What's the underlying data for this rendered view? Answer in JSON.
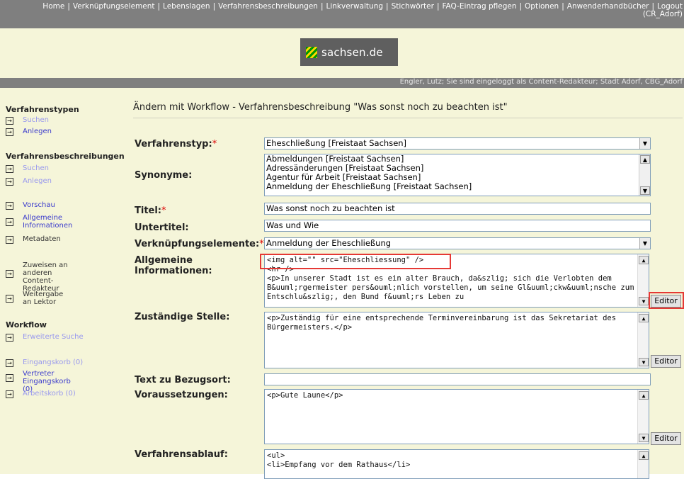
{
  "topnav": {
    "links": [
      "Home",
      "Verknüpfungselement",
      "Lebenslagen",
      "Verfahrensbeschreibungen",
      "Linkverwaltung",
      "Stichwörter",
      "FAQ-Eintrag pflegen",
      "Optionen",
      "Anwenderhandbücher",
      "Logout"
    ],
    "user_code": "(CR_Adorf)"
  },
  "logo": {
    "text": "sachsen.de"
  },
  "userbar": {
    "text": "Engler, Lutz; Sie sind eingeloggt als Content-Redakteur; Stadt Adorf, CBG_Adorf"
  },
  "sidebar": {
    "sections": [
      {
        "title": "Verfahrenstypen",
        "items": [
          "Suchen",
          "Anlegen"
        ]
      },
      {
        "title": "Verfahrensbeschreibungen",
        "items": [
          "Suchen",
          "Anlegen"
        ]
      },
      {
        "items": [
          "Vorschau",
          "Allgemeine Informationen",
          "Metadaten"
        ]
      },
      {
        "items": [
          "Zuweisen an anderen Content-Redakteur",
          "Weitergabe an Lektor"
        ]
      },
      {
        "title": "Workflow",
        "items": [
          "Erweiterte Suche",
          "Eingangskorb (0)",
          "Vertreter Eingangskorb (0)",
          "Arbeitskorb (0)"
        ]
      }
    ]
  },
  "page": {
    "title": "Ändern mit Workflow -  Verfahrensbeschreibung  \"Was sonst noch zu beachten ist\""
  },
  "form": {
    "verfahrenstyp": {
      "label": "Verfahrenstyp:",
      "required_mark": "*",
      "value": "Eheschließung [Freistaat Sachsen]"
    },
    "synonyme": {
      "label": "Synonyme:",
      "options": [
        "Abmeldungen [Freistaat Sachsen]",
        "Adressänderungen [Freistaat Sachsen]",
        "Agentur für Arbeit [Freistaat Sachsen]",
        "Anmeldung der Eheschließung [Freistaat Sachsen]"
      ]
    },
    "titel": {
      "label": "Titel:",
      "required_mark": "*",
      "value": "Was sonst noch zu beachten ist"
    },
    "untertitel": {
      "label": "Untertitel:",
      "value": "Was und Wie"
    },
    "verknuepfung": {
      "label": "Verknüpfungselemente:",
      "required_mark": "*",
      "value": "Anmeldung der Eheschließung"
    },
    "allgemeine": {
      "label_line1": "Allgemeine",
      "label_line2": "Informationen:",
      "content": "<img alt=\"\" src=\"Eheschliessung\" />\n<hr />\n<p>In unserer Stadt ist es ein alter Brauch, da&szlig; sich die Verlobten dem B&uuml;rgermeister pers&ouml;nlich vorstellen, um seine Gl&uuml;ckw&uuml;nsche zum Entschlu&szlig;, den Bund f&uuml;rs Leben zu"
    },
    "zustaendige": {
      "label": "Zuständige Stelle:",
      "content": "<p>Zuständig für eine entsprechende Terminvereinbarung ist das Sekretariat des Bürgermeisters.</p>"
    },
    "bezugsort": {
      "label": "Text zu Bezugsort:",
      "value": ""
    },
    "voraussetzungen": {
      "label": "Voraussetzungen:",
      "content": "<p>Gute Laune</p>"
    },
    "ablauf": {
      "label": "Verfahrensablauf:",
      "content": "<ul>\n<li>Empfang vor dem Rathaus</li>"
    },
    "editor_label": "Editor"
  },
  "colors": {
    "nav_bg": "#7f7f7f",
    "panel_bg": "#f5f5d9",
    "link": "#3a3acc",
    "required": "#dd0000",
    "highlight": "#e53935"
  }
}
